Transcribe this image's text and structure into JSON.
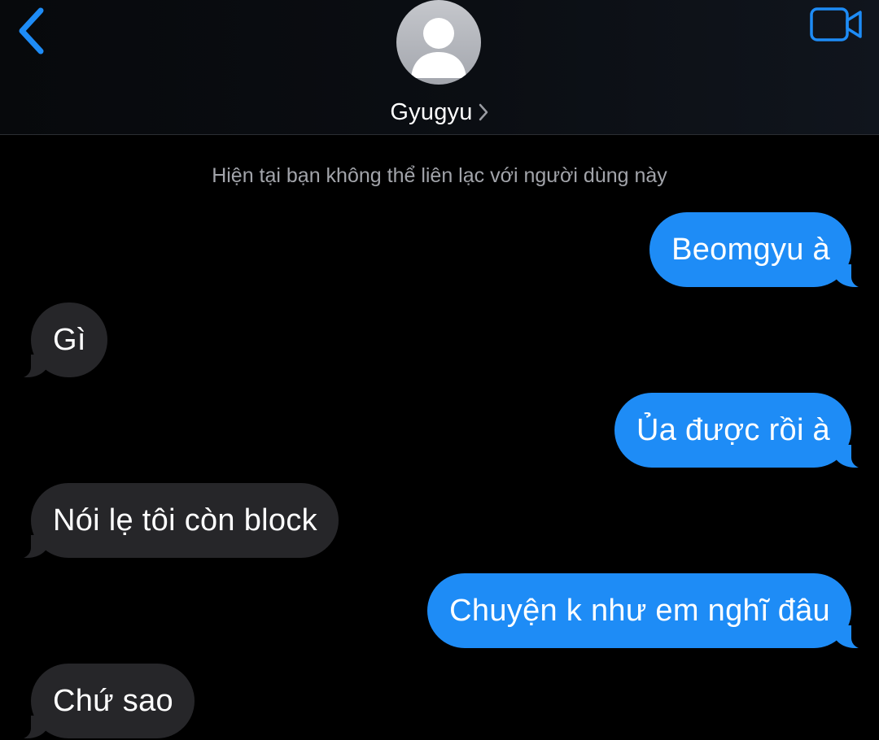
{
  "header": {
    "contact_name": "Gyugyu",
    "back_icon": "chevron-left-icon",
    "video_icon": "video-camera-icon",
    "avatar_icon": "default-person-avatar",
    "accent_color": "#1e8cf6"
  },
  "notice": {
    "text": "Hiện tại bạn không thể liên lạc với người dùng này"
  },
  "messages": [
    {
      "direction": "outgoing",
      "text": "Beomgyu à"
    },
    {
      "direction": "incoming",
      "text": "Gì"
    },
    {
      "direction": "outgoing",
      "text": "Ủa được rồi à"
    },
    {
      "direction": "incoming",
      "text": "Nói lẹ tôi còn block"
    },
    {
      "direction": "outgoing",
      "text": "Chuyện k như em nghĩ đâu"
    },
    {
      "direction": "incoming",
      "text": "Chứ sao"
    }
  ],
  "colors": {
    "outgoing_bubble": "#1e8cf6",
    "incoming_bubble": "#262629",
    "background": "#000000",
    "notice_text": "#a2a4aa"
  }
}
